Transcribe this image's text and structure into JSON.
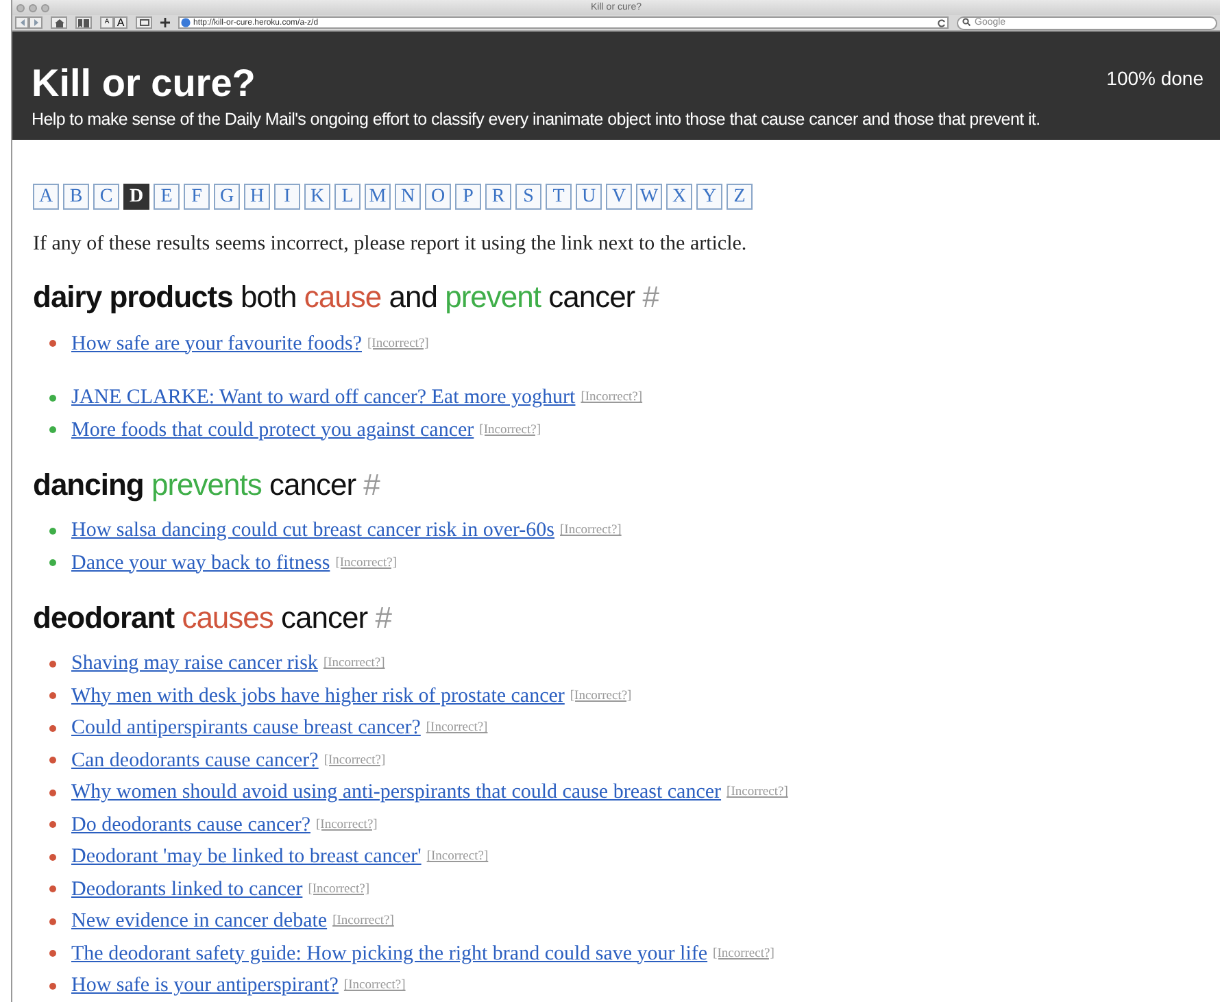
{
  "window": {
    "title": "Kill or cure?"
  },
  "toolbar": {
    "url": "http://kill-or-cure.heroku.com/a-z/d",
    "text_size_buttons": [
      "A",
      "A"
    ],
    "search": {
      "placeholder": "Google"
    }
  },
  "header": {
    "title": "Kill or cure?",
    "subtitle": "Help to make sense of the Daily Mail's ongoing effort to classify every inanimate object into those that cause cancer and those that prevent it.",
    "progress": "100% done"
  },
  "letters": [
    {
      "label": "A",
      "selected": false
    },
    {
      "label": "B",
      "selected": false
    },
    {
      "label": "C",
      "selected": false
    },
    {
      "label": "D",
      "selected": true
    },
    {
      "label": "E",
      "selected": false
    },
    {
      "label": "F",
      "selected": false
    },
    {
      "label": "G",
      "selected": false
    },
    {
      "label": "H",
      "selected": false
    },
    {
      "label": "I",
      "selected": false
    },
    {
      "label": "K",
      "selected": false
    },
    {
      "label": "L",
      "selected": false
    },
    {
      "label": "M",
      "selected": false
    },
    {
      "label": "N",
      "selected": false
    },
    {
      "label": "O",
      "selected": false
    },
    {
      "label": "P",
      "selected": false
    },
    {
      "label": "R",
      "selected": false
    },
    {
      "label": "S",
      "selected": false
    },
    {
      "label": "T",
      "selected": false
    },
    {
      "label": "U",
      "selected": false
    },
    {
      "label": "V",
      "selected": false
    },
    {
      "label": "W",
      "selected": false
    },
    {
      "label": "X",
      "selected": false
    },
    {
      "label": "Y",
      "selected": false
    },
    {
      "label": "Z",
      "selected": false
    }
  ],
  "note": "If any of these results seems incorrect, please report it using the link next to the article.",
  "sections": [
    {
      "heading": [
        {
          "kind": "subject",
          "text": "dairy products"
        },
        {
          "kind": "plain",
          "text": "both"
        },
        {
          "kind": "cause",
          "text": "cause"
        },
        {
          "kind": "plain",
          "text": "and"
        },
        {
          "kind": "prevent",
          "text": "prevent"
        },
        {
          "kind": "plain",
          "text": "cancer"
        },
        {
          "kind": "hash",
          "text": "#"
        }
      ],
      "groups": [
        {
          "color": "#d0553c",
          "items": [
            {
              "title": "How safe are your favourite foods?",
              "report": "[Incorrect?]"
            }
          ]
        },
        {
          "color": "#3fae49",
          "items": [
            {
              "title": "JANE CLARKE: Want to ward off cancer? Eat more yoghurt",
              "report": "[Incorrect?]"
            },
            {
              "title": "More foods that could protect you against cancer",
              "report": "[Incorrect?]"
            }
          ]
        }
      ]
    },
    {
      "heading": [
        {
          "kind": "subject",
          "text": "dancing"
        },
        {
          "kind": "prevent",
          "text": "prevents"
        },
        {
          "kind": "plain",
          "text": "cancer"
        },
        {
          "kind": "hash",
          "text": "#"
        }
      ],
      "groups": [
        {
          "color": "#3fae49",
          "items": [
            {
              "title": "How salsa dancing could cut breast cancer risk in over-60s",
              "report": "[Incorrect?]"
            },
            {
              "title": "Dance your way back to fitness",
              "report": "[Incorrect?]"
            }
          ]
        }
      ]
    },
    {
      "heading": [
        {
          "kind": "subject",
          "text": "deodorant"
        },
        {
          "kind": "cause",
          "text": "causes"
        },
        {
          "kind": "plain",
          "text": "cancer"
        },
        {
          "kind": "hash",
          "text": "#"
        }
      ],
      "groups": [
        {
          "color": "#d0553c",
          "items": [
            {
              "title": "Shaving may raise cancer risk",
              "report": "[Incorrect?]"
            },
            {
              "title": "Why men with desk jobs have higher risk of prostate cancer",
              "report": "[Incorrect?]"
            },
            {
              "title": "Could antiperspirants cause breast cancer?",
              "report": "[Incorrect?]"
            },
            {
              "title": "Can deodorants cause cancer?",
              "report": "[Incorrect?]"
            },
            {
              "title": "Why women should avoid using anti-perspirants that could cause breast cancer",
              "report": "[Incorrect?]"
            },
            {
              "title": "Do deodorants cause cancer?",
              "report": "[Incorrect?]"
            },
            {
              "title": "Deodorant 'may be linked to breast cancer'",
              "report": "[Incorrect?]"
            },
            {
              "title": "Deodorants linked to cancer",
              "report": "[Incorrect?]"
            },
            {
              "title": "New evidence in cancer debate",
              "report": "[Incorrect?]"
            },
            {
              "title": "The deodorant safety guide: How picking the right brand could save your life",
              "report": "[Incorrect?]"
            },
            {
              "title": "How safe is your antiperspirant?",
              "report": "[Incorrect?]"
            }
          ]
        }
      ]
    }
  ]
}
